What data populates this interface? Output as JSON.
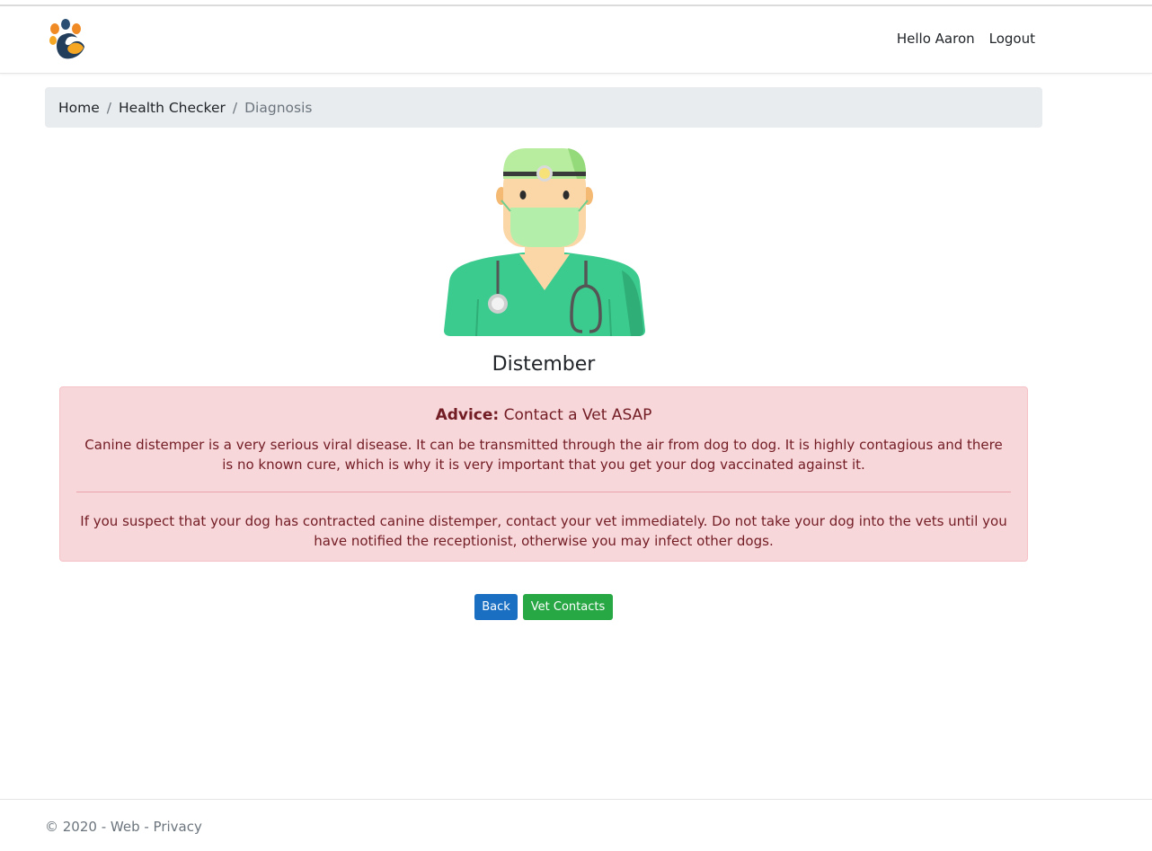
{
  "nav": {
    "greeting": "Hello Aaron",
    "logout": "Logout"
  },
  "breadcrumb": {
    "home": "Home",
    "separator": "/",
    "health_checker": "Health Checker",
    "current": "Diagnosis"
  },
  "diagnosis": {
    "title": "Distember",
    "advice_label": "Advice:",
    "advice_text": " Contact a Vet ASAP",
    "paragraph1": "Canine distemper is a very serious viral disease. It can be transmitted through the air from dog to dog. It is highly contagious and there is no known cure, which is why it is very important that you get your dog vaccinated against it.",
    "paragraph2": "If you suspect that your dog has contracted canine distemper, contact your vet immediately. Do not take your dog into the vets until you have notified the receptionist, otherwise you may infect other dogs."
  },
  "buttons": {
    "back": "Back",
    "vet_contacts": "Vet Contacts"
  },
  "footer": {
    "copyright": "© 2020 - Web - ",
    "privacy": "Privacy"
  },
  "icons": {
    "logo": "paw-logo-icon",
    "doctor": "doctor-avatar-icon"
  },
  "colors": {
    "alert_bg": "#f8d7da",
    "alert_text": "#721c24",
    "back_button": "#1a6fc2",
    "vet_button": "#28a745"
  }
}
